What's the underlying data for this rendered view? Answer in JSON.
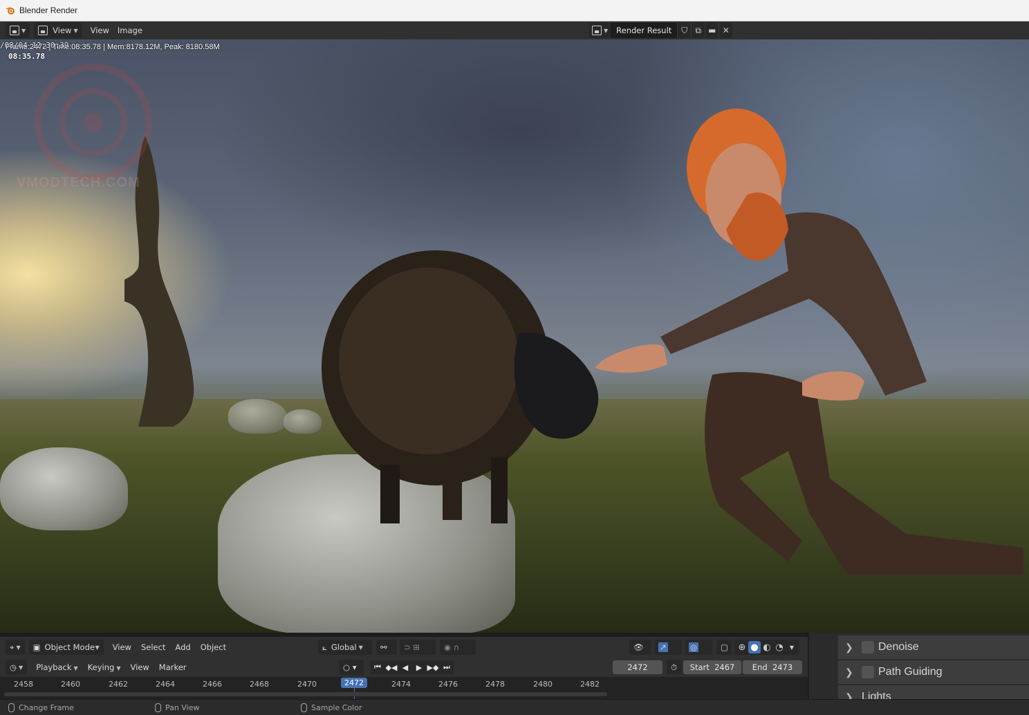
{
  "window": {
    "title": "Blender Render"
  },
  "image_header": {
    "menus": [
      "View",
      "View",
      "Image"
    ],
    "image_name": "Render Result"
  },
  "render": {
    "stats_line1": "Frame:2472 | Time:08:35.78 | Mem:8178.12M, Peak: 8180.58M",
    "stats_date": "/08/04 12:30:39",
    "stats_time": "08:35.78",
    "watermark": "VMODTECH.COM"
  },
  "viewport_header": {
    "mode": "Object Mode",
    "menus": [
      "View",
      "Select",
      "Add",
      "Object"
    ],
    "orientation": "Global"
  },
  "timeline": {
    "playback": "Playback",
    "keying": "Keying",
    "view": "View",
    "marker": "Marker",
    "current_frame": "2472",
    "start_label": "Start",
    "start": "2467",
    "end_label": "End",
    "end": "2473",
    "ticks": [
      "2458",
      "2460",
      "2462",
      "2464",
      "2466",
      "2468",
      "2470",
      "2472",
      "2474",
      "2476",
      "2478",
      "2480",
      "2482"
    ]
  },
  "properties": {
    "rows": [
      "Denoise",
      "Path Guiding",
      "Lights"
    ]
  },
  "statusbar": {
    "left": "Change Frame",
    "middle": "Pan View",
    "right": "Sample Color"
  },
  "colors": {
    "accent": "#4772b3",
    "header": "#303030",
    "panel": "#2b2b2b"
  }
}
